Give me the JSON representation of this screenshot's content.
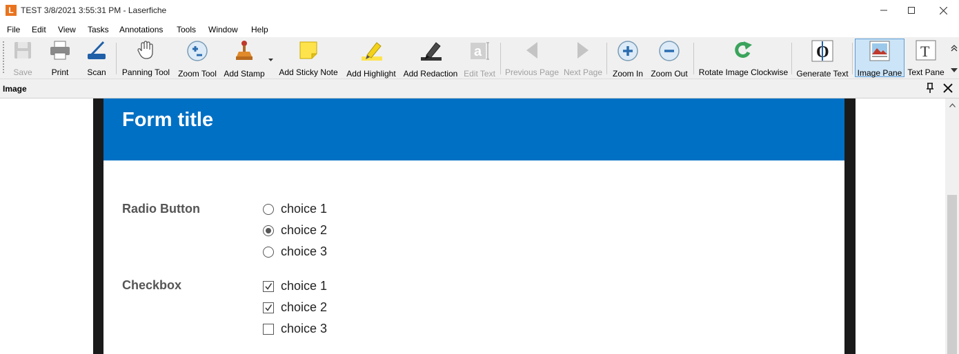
{
  "window": {
    "app_letter": "L",
    "title": "TEST 3/8/2021 3:55:31 PM - Laserfiche"
  },
  "menu": [
    "File",
    "Edit",
    "View",
    "Tasks",
    "Annotations",
    "Tools",
    "Window",
    "Help"
  ],
  "toolbar": {
    "save": "Save",
    "print": "Print",
    "scan": "Scan",
    "panning_tool": "Panning Tool",
    "zoom_tool": "Zoom Tool",
    "add_stamp": "Add Stamp",
    "add_sticky_note": "Add Sticky Note",
    "add_highlight": "Add Highlight",
    "add_redaction": "Add Redaction",
    "edit_text": "Edit Text",
    "previous_page": "Previous Page",
    "next_page": "Next Page",
    "zoom_in": "Zoom In",
    "zoom_out": "Zoom Out",
    "rotate_image_clockwise": "Rotate Image Clockwise",
    "generate_text": "Generate Text",
    "image_pane": "Image Pane",
    "text_pane": "Text Pane"
  },
  "pane": {
    "title": "Image"
  },
  "form": {
    "title": "Form title",
    "radio": {
      "label": "Radio Button",
      "choices": [
        "choice 1",
        "choice 2",
        "choice 3"
      ],
      "selected_index": 1
    },
    "checkbox": {
      "label": "Checkbox",
      "choices": [
        "choice 1",
        "choice 2",
        "choice 3"
      ],
      "checked": [
        true,
        true,
        false
      ]
    }
  },
  "colors": {
    "form_header": "#0070c4",
    "app_logo": "#e8741f"
  }
}
